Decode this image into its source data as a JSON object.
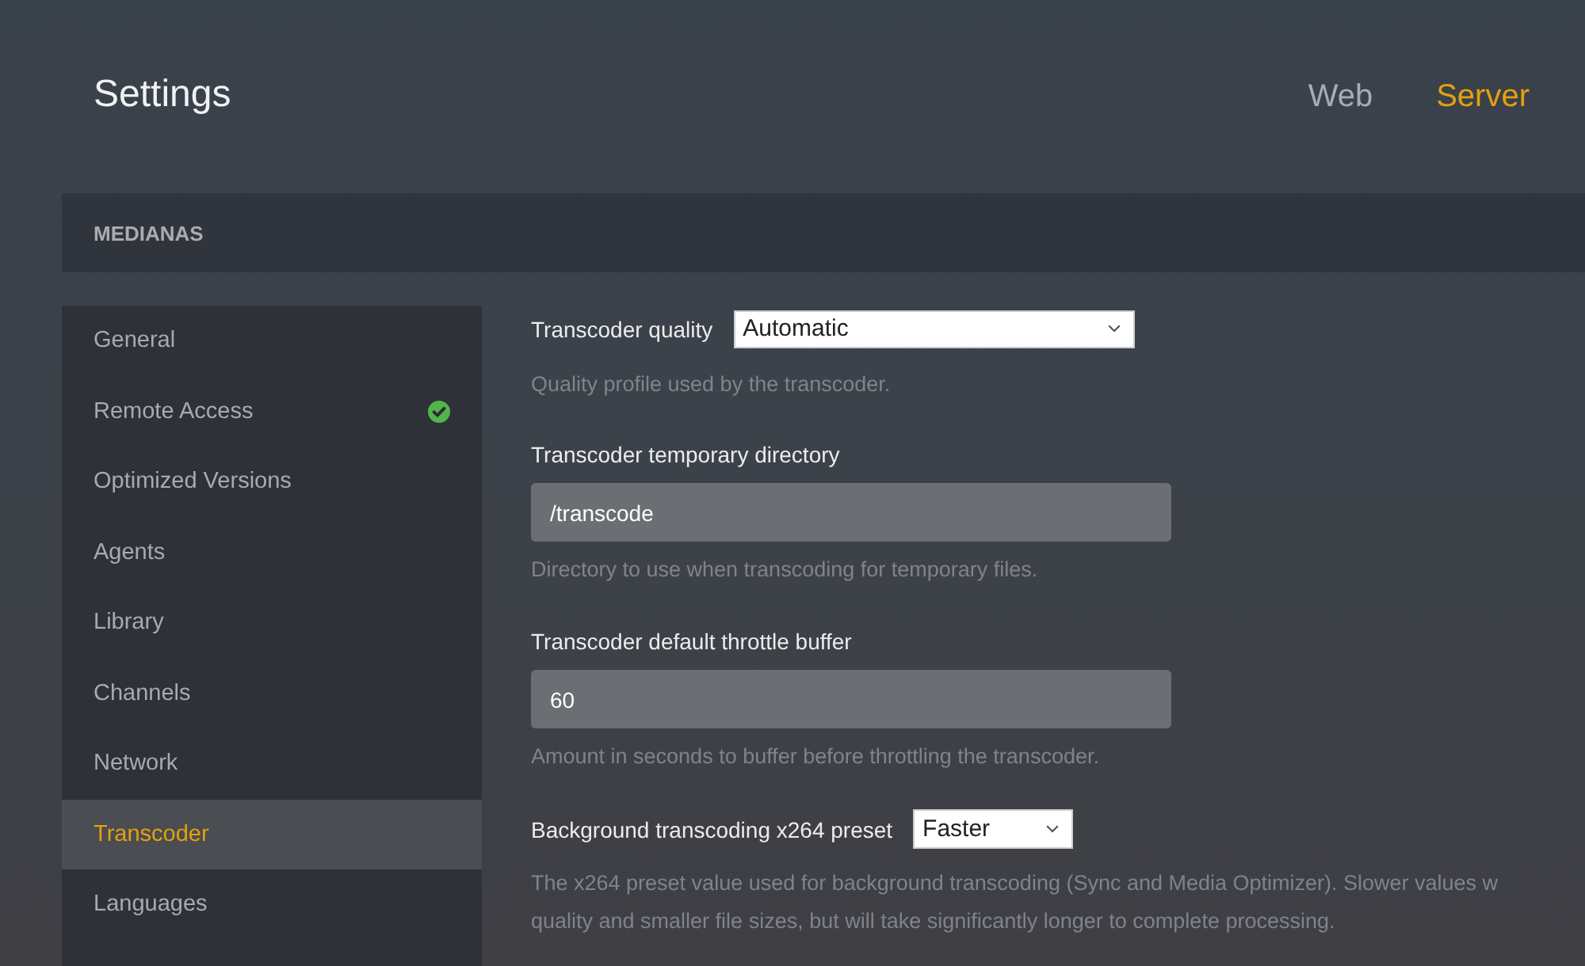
{
  "header": {
    "title": "Settings",
    "tabs": [
      {
        "label": "Web",
        "selected": false
      },
      {
        "label": "Server",
        "selected": true
      }
    ]
  },
  "server_bar": {
    "name": "MEDIANAS"
  },
  "sidebar": {
    "items": [
      {
        "label": "General",
        "selected": false,
        "verified": false
      },
      {
        "label": "Remote Access",
        "selected": false,
        "verified": true
      },
      {
        "label": "Optimized Versions",
        "selected": false,
        "verified": false
      },
      {
        "label": "Agents",
        "selected": false,
        "verified": false
      },
      {
        "label": "Library",
        "selected": false,
        "verified": false
      },
      {
        "label": "Channels",
        "selected": false,
        "verified": false
      },
      {
        "label": "Network",
        "selected": false,
        "verified": false
      },
      {
        "label": "Transcoder",
        "selected": true,
        "verified": false
      },
      {
        "label": "Languages",
        "selected": false,
        "verified": false
      }
    ]
  },
  "settings": [
    {
      "kind": "select",
      "label": "Transcoder quality",
      "value": "Automatic",
      "help": [
        "Quality profile used by the transcoder."
      ]
    },
    {
      "kind": "text",
      "label": "Transcoder temporary directory",
      "value": "/transcode",
      "help": [
        "Directory to use when transcoding for temporary files."
      ]
    },
    {
      "kind": "text",
      "label": "Transcoder default throttle buffer",
      "value": "60",
      "help": [
        "Amount in seconds to buffer before throttling the transcoder."
      ]
    },
    {
      "kind": "select",
      "label": "Background transcoding x264 preset",
      "value": "Faster",
      "help": [
        "The x264 preset value used for background transcoding (Sync and Media Optimizer). Slower values w",
        "quality and smaller file sizes, but will take significantly longer to complete processing."
      ]
    }
  ]
}
